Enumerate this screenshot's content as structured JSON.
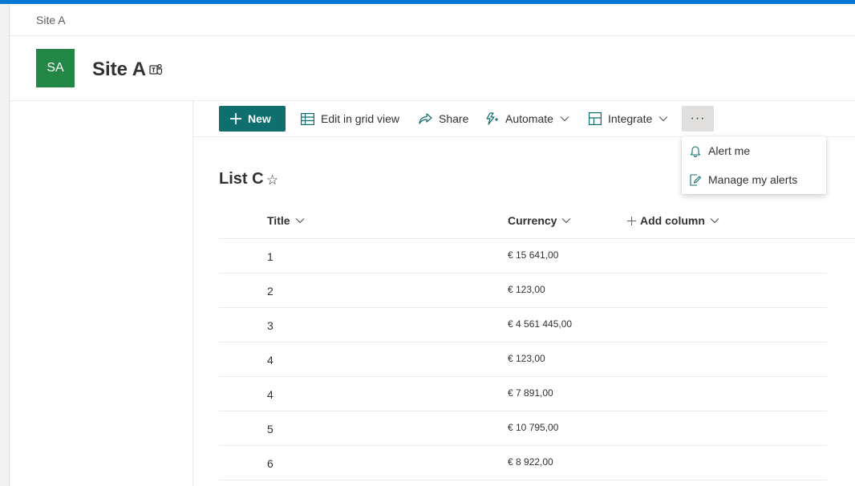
{
  "breadcrumb": "Site A",
  "site": {
    "logo_text": "SA",
    "title": "Site A",
    "logo_color": "#238745"
  },
  "toolbar": {
    "new_label": "New",
    "edit_grid_label": "Edit in grid view",
    "share_label": "Share",
    "automate_label": "Automate",
    "integrate_label": "Integrate",
    "more_label": "···"
  },
  "more_menu": {
    "items": [
      {
        "label": "Alert me",
        "icon": "bell-icon"
      },
      {
        "label": "Manage my alerts",
        "icon": "edit-alerts-icon"
      }
    ]
  },
  "list": {
    "title": "List C",
    "columns": {
      "title": "Title",
      "currency": "Currency",
      "add_column": "Add column"
    },
    "rows": [
      {
        "title": "1",
        "currency": "€ 15 641,00"
      },
      {
        "title": "2",
        "currency": "€ 123,00"
      },
      {
        "title": "3",
        "currency": "€ 4 561 445,00"
      },
      {
        "title": "4",
        "currency": "€ 123,00"
      },
      {
        "title": "4",
        "currency": "€ 7 891,00"
      },
      {
        "title": "5",
        "currency": "€ 10 795,00"
      },
      {
        "title": "6",
        "currency": "€ 8 922,00"
      }
    ]
  },
  "colors": {
    "accent": "#0f6e6e",
    "suite_bar": "#0078d4"
  }
}
